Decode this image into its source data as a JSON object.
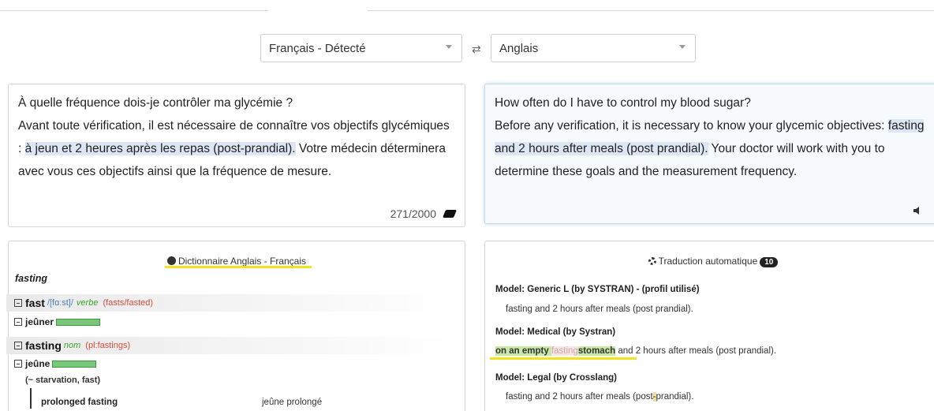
{
  "source_lang": {
    "value": "Français - Détecté"
  },
  "swap_icon": "swap-arrows-icon",
  "target_lang": {
    "value": "Anglais"
  },
  "source_text": {
    "line1": "À quelle fréquence dois-je contrôler ma glycémie ?",
    "p2_before": "Avant toute vérification, il est nécessaire de connaître vos objectifs glycémiques",
    "p2_sep": " : ",
    "p2_highlight": "à jeun et 2 heures après les repas (post-prandial).",
    "p2_after": " Votre médecin déterminera avec vous ces objectifs ainsi que la fréquence de mesure.",
    "counter": "271/2000"
  },
  "target_text": {
    "line1": "How often do I have to control my blood sugar?",
    "p2_before": "Before any verification, it is necessary to know your glycemic objectives: ",
    "p2_highlight": "fasting and 2 hours after meals (post prandial).",
    "p2_after": " Your doctor will work with you to determine these goals and the measurement frequency."
  },
  "dictionary": {
    "header": "Dictionnaire Anglais - Français",
    "word": "fasting",
    "entries": [
      {
        "lemma": "fast",
        "phonetic": "/[fɑːst]/",
        "pos": "verbe",
        "inflection": "(fasts/fasted)",
        "translation": "jeûner"
      },
      {
        "lemma": "fasting",
        "phonetic": "",
        "pos": "nom",
        "inflection": "(pl:fastings)",
        "translation": "jeûne"
      }
    ],
    "sense": "(~ starvation, fast)",
    "example": {
      "en": "prolonged fasting",
      "fr": "jeûne prolongé"
    }
  },
  "auto_translation": {
    "header": "Traduction automatique",
    "count": "10",
    "models": [
      {
        "name": "Model: Generic L (by SYSTRAN) - (profil utilisé)",
        "text": "fasting and 2 hours after meals (post prandial).",
        "icon": "eye-slash-icon"
      },
      {
        "name": "Model: Medical (by Systran)",
        "seg1": "on an empty ",
        "seg_deleted": "fasting",
        "seg2": "stomach",
        "seg_rest": " and 2 hours after meals (post prandial).",
        "icon": "undo-icon"
      },
      {
        "name": "Model: Legal (by Crosslang)",
        "seg_a": "fasting and 2 hours after meals (post",
        "seg_ins": "-",
        "seg_b": "prandial).",
        "icon": "undo-icon"
      }
    ]
  },
  "colors": {
    "highlight": "#dde6f4",
    "green_match": "#78c77a",
    "annotation_yellow": "#f2e41c"
  }
}
